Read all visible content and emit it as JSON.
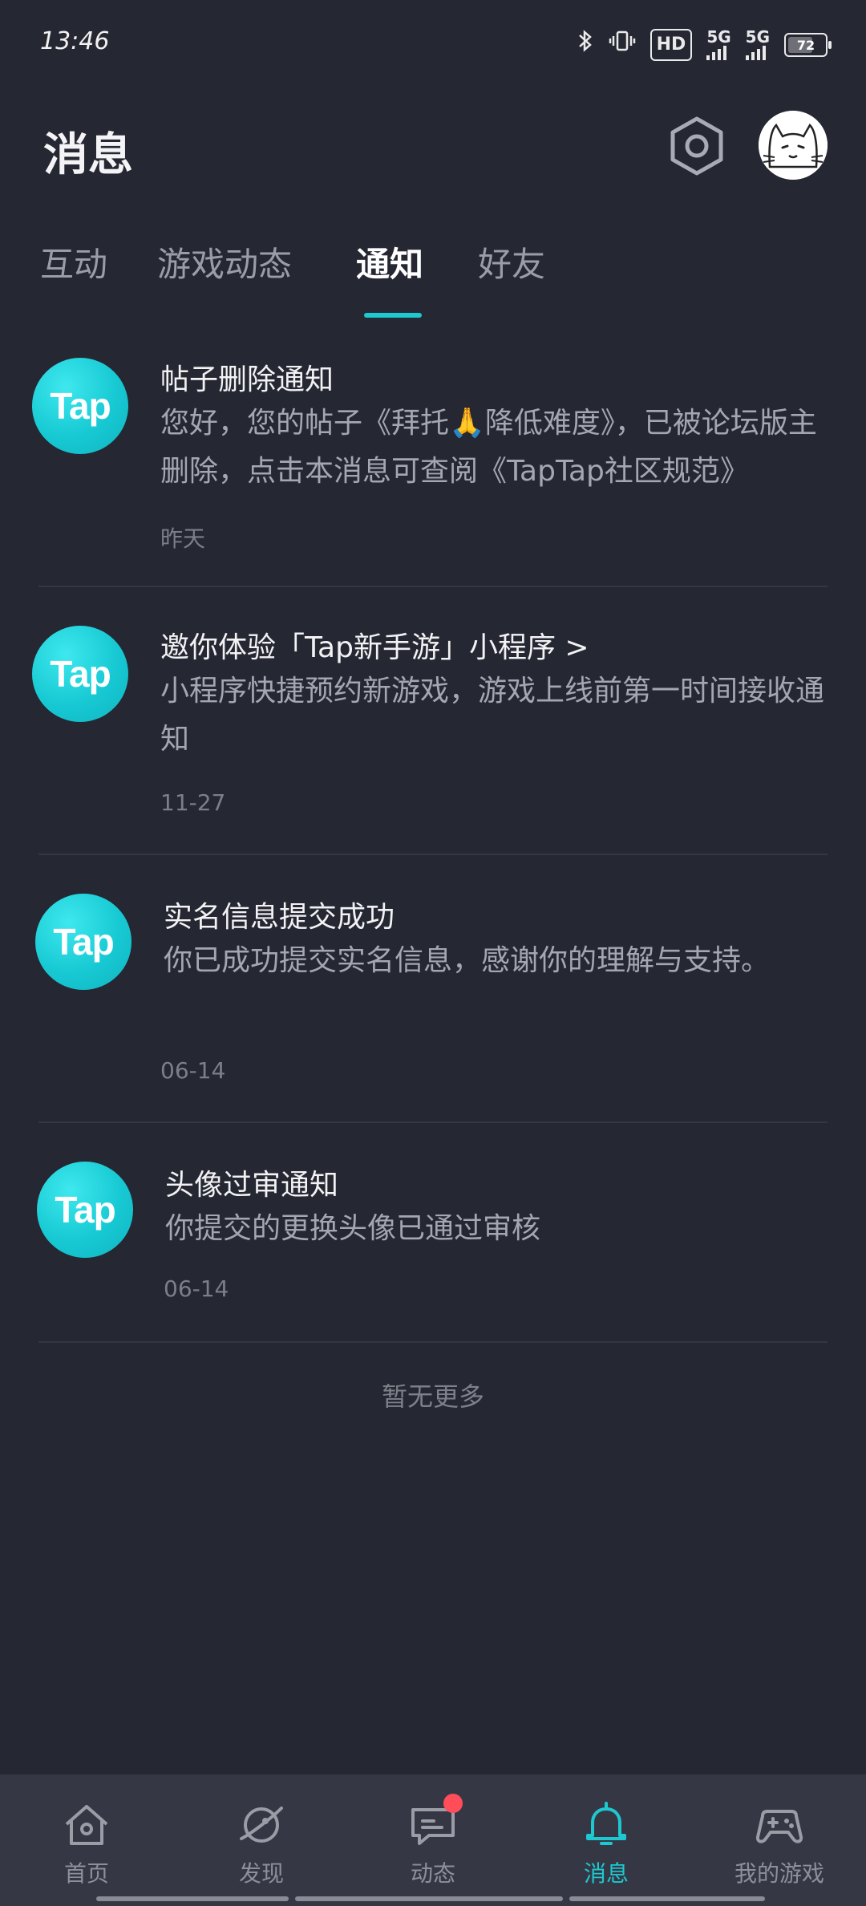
{
  "status_bar": {
    "time": "13:46",
    "hd_label": "HD",
    "net1": "5G",
    "net2": "5G",
    "battery": "72",
    "battery_level": 0.72
  },
  "header": {
    "title": "消息",
    "settings_icon": "settings-hexagon-icon",
    "avatar_icon": "cat-avatar"
  },
  "tabs": [
    {
      "label": "互动",
      "active": false
    },
    {
      "label": "游戏动态",
      "active": false
    },
    {
      "label": "通知",
      "active": true
    },
    {
      "label": "好友",
      "active": false
    }
  ],
  "notifications": [
    {
      "avatar_text": "Tap",
      "title": "帖子删除通知",
      "body": "您好，您的帖子《拜托🙏降低难度》，已被论坛版主删除，点击本消息可查阅《TapTap社区规范》",
      "date": "昨天"
    },
    {
      "avatar_text": "Tap",
      "title": "邀你体验「Tap新手游」小程序 >",
      "body": "小程序快捷预约新游戏，游戏上线前第一时间接收通知",
      "date": "11-27"
    },
    {
      "avatar_text": "Tap",
      "title": "实名信息提交成功",
      "body": "你已成功提交实名信息，感谢你的理解与支持。",
      "date": "06-14"
    },
    {
      "avatar_text": "Tap",
      "title": "头像过审通知",
      "body": "你提交的更换头像已通过审核",
      "date": "06-14"
    }
  ],
  "footer_text": "暂无更多",
  "bottom_nav": [
    {
      "label": "首页",
      "icon": "home-icon",
      "active": false
    },
    {
      "label": "发现",
      "icon": "planet-icon",
      "active": false
    },
    {
      "label": "动态",
      "icon": "chat-icon",
      "active": false,
      "badge": true
    },
    {
      "label": "消息",
      "icon": "bell-icon",
      "active": true
    },
    {
      "label": "我的游戏",
      "icon": "gamepad-icon",
      "active": false
    }
  ],
  "colors": {
    "background": "#252732",
    "accent": "#1ec8d0",
    "badge": "#ff4d5a",
    "nav_background": "#353844"
  }
}
